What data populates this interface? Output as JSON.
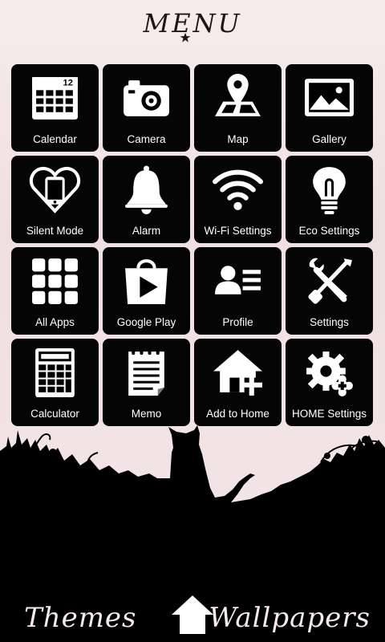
{
  "header": {
    "title": "MENU"
  },
  "tiles": [
    {
      "label": "Calendar",
      "icon": "calendar-icon",
      "date": "12"
    },
    {
      "label": "Camera",
      "icon": "camera-icon"
    },
    {
      "label": "Map",
      "icon": "map-pin-icon"
    },
    {
      "label": "Gallery",
      "icon": "gallery-icon"
    },
    {
      "label": "Silent Mode",
      "icon": "silent-mode-icon"
    },
    {
      "label": "Alarm",
      "icon": "bell-icon"
    },
    {
      "label": "Wi-Fi Settings",
      "icon": "wifi-icon"
    },
    {
      "label": "Eco Settings",
      "icon": "light-bulb-icon"
    },
    {
      "label": "All Apps",
      "icon": "app-grid-icon"
    },
    {
      "label": "Google Play",
      "icon": "play-store-icon"
    },
    {
      "label": "Profile",
      "icon": "profile-icon"
    },
    {
      "label": "Settings",
      "icon": "tools-icon"
    },
    {
      "label": "Calculator",
      "icon": "calculator-icon"
    },
    {
      "label": "Memo",
      "icon": "notepad-icon"
    },
    {
      "label": "Add to Home",
      "icon": "add-home-icon"
    },
    {
      "label": "HOME Settings",
      "icon": "home-gear-icon"
    }
  ],
  "bottom_nav": {
    "left": "Themes",
    "center_icon": "home-icon",
    "right": "Wallpapers"
  },
  "colors": {
    "background": "#f1dee0",
    "tile": "#050505",
    "tile_text": "#ffffff",
    "silhouette": "#000000"
  }
}
